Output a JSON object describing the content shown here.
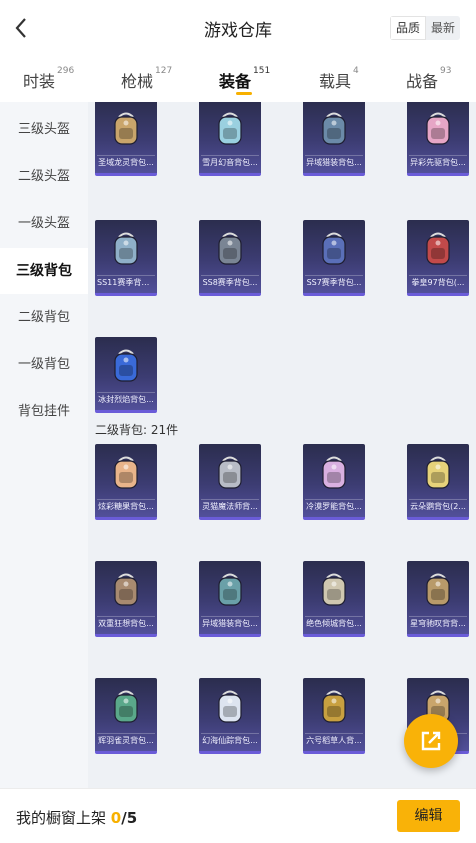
{
  "header": {
    "title": "游戏仓库",
    "sort_quality": "品质",
    "sort_latest": "最新"
  },
  "tabs": [
    {
      "label": "时装",
      "count": "296"
    },
    {
      "label": "枪械",
      "count": "127"
    },
    {
      "label": "装备",
      "count": "151"
    },
    {
      "label": "载具",
      "count": "4"
    },
    {
      "label": "战备",
      "count": "93"
    }
  ],
  "sidebar": [
    "三级头盔",
    "二级头盔",
    "一级头盔",
    "三级背包",
    "二级背包",
    "一级背包",
    "背包挂件"
  ],
  "content": {
    "section2_label": "二级背包: 21件",
    "items_top": [
      "圣域龙灵背包...",
      "雪月幻音背包...",
      "异域猎装背包...",
      "异彩先驱背包..."
    ],
    "items_lvl3": [
      "SS11赛季背包...",
      "SS8赛季背包...",
      "SS7赛季背包...",
      "拳皇97背包(...",
      "冰封烈焰背包..."
    ],
    "items_lvl2": [
      "炫彩糖果背包...",
      "灵猫魔法师背...",
      "冷漠罗能背包...",
      "云朵鹦背包(2...",
      "双重狂想背包...",
      "异域猎装背包...",
      "绝色倾城背包...",
      "星穹驰叹背背...",
      "辉羽雀灵背包...",
      "幻海仙踪背包...",
      "六号稻草人背..."
    ]
  },
  "bottom": {
    "label": "我的橱窗上架 ",
    "count": "0",
    "max": "/5",
    "edit": "编辑"
  },
  "colors": {
    "accent": "#f9b208",
    "card_bg": "#3c3c72",
    "card_border": "#6a5cd8"
  },
  "icons": {
    "back": "chevron-left-icon",
    "share": "share-icon"
  }
}
